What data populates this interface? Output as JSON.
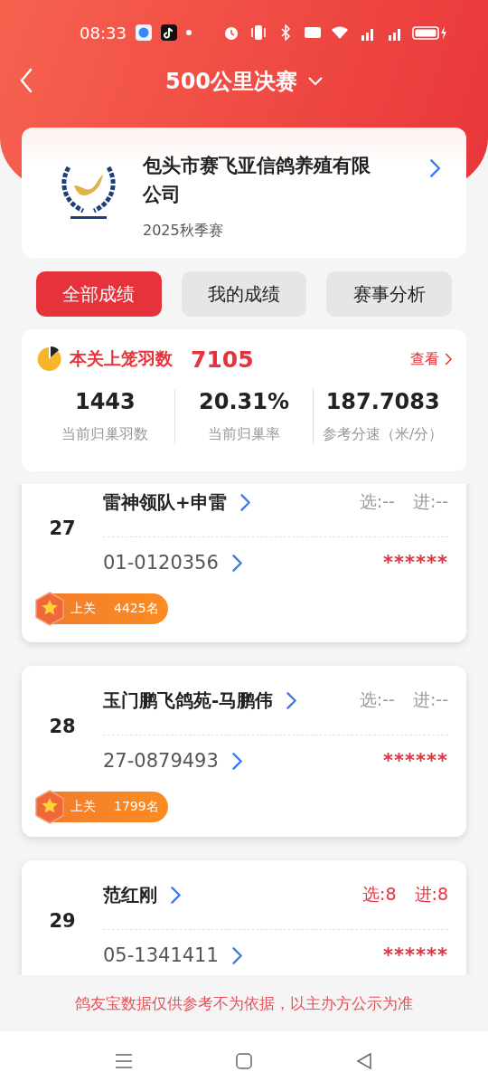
{
  "status_bar": {
    "time": "08:33"
  },
  "header": {
    "title": "500公里决赛"
  },
  "club": {
    "name": "包头市赛飞亚信鸽养殖有限公司",
    "season": "2025秋季赛"
  },
  "tabs": [
    {
      "label": "全部成绩",
      "selected": true
    },
    {
      "label": "我的成绩",
      "selected": false
    },
    {
      "label": "赛事分析",
      "selected": false
    }
  ],
  "summary": {
    "label": "本关上笼羽数",
    "count": "7105",
    "link": "查看",
    "stats": [
      {
        "value": "1443",
        "label": "当前归巢羽数"
      },
      {
        "value": "20.31%",
        "label": "当前归巢率"
      },
      {
        "value": "187.7083",
        "label": "参考分速（米/分）"
      }
    ]
  },
  "results": [
    {
      "rank": "27",
      "name": "雷神领队+申雷",
      "picked": "选:--",
      "entered": "进:--",
      "highlighted": false,
      "ring": "01-0120356",
      "speed": "******",
      "badge": {
        "label": "上关",
        "place": "4425名"
      }
    },
    {
      "rank": "28",
      "name": "玉门鹏飞鸽苑-马鹏伟",
      "picked": "选:--",
      "entered": "进:--",
      "highlighted": false,
      "ring": "27-0879493",
      "speed": "******",
      "badge": {
        "label": "上关",
        "place": "1799名"
      }
    },
    {
      "rank": "29",
      "name": "范红刚",
      "picked": "选:8",
      "entered": "进:8",
      "highlighted": true,
      "ring": "05-1341411",
      "speed": "******"
    }
  ],
  "notice": "鸽友宝数据仅供参考不为依据，以主办方公示为准"
}
